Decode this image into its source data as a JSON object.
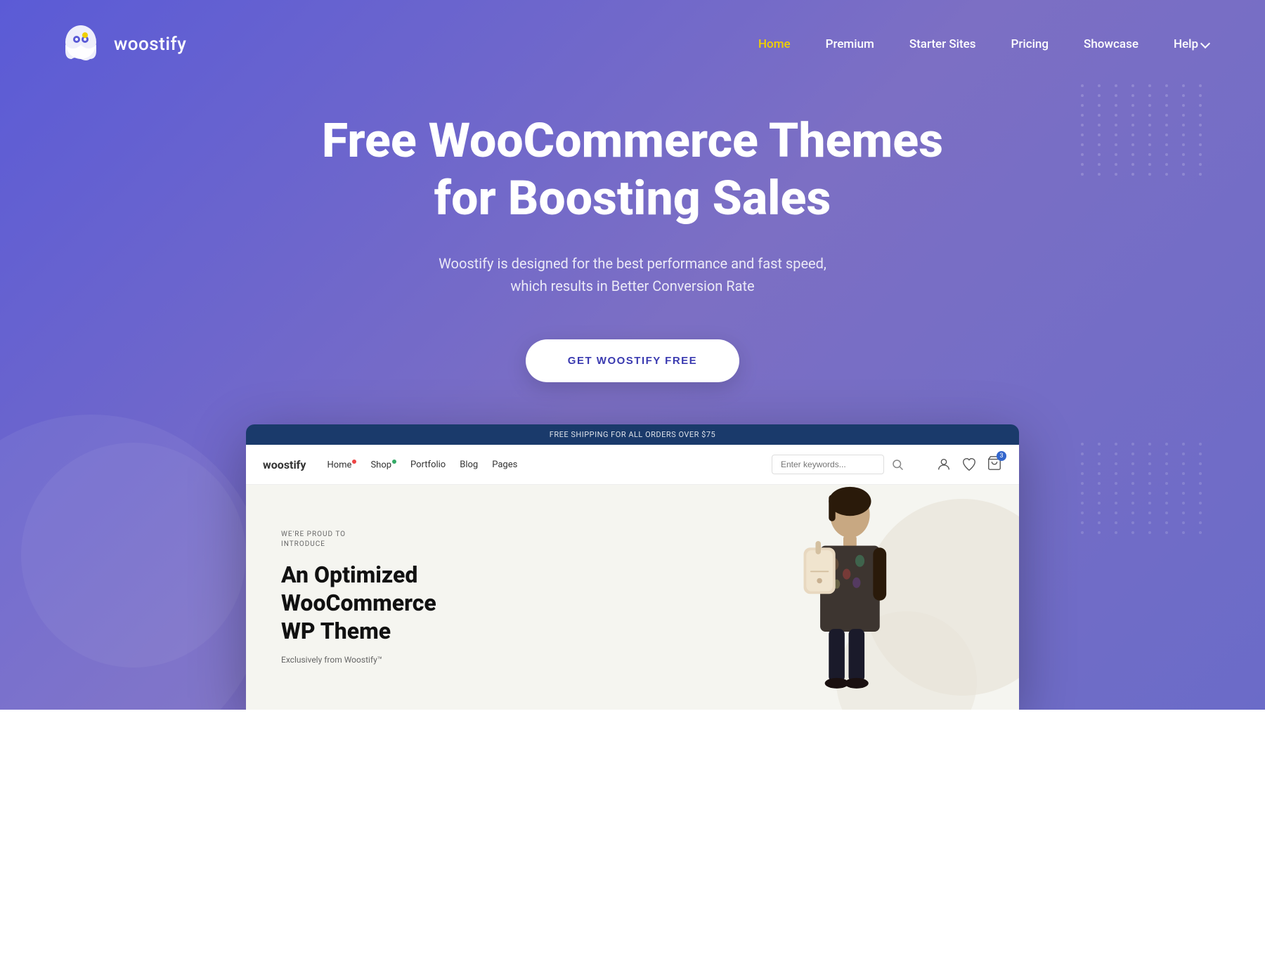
{
  "logo": {
    "text": "woostify"
  },
  "nav": {
    "items": [
      {
        "label": "Home",
        "active": true
      },
      {
        "label": "Premium",
        "active": false
      },
      {
        "label": "Starter Sites",
        "active": false
      },
      {
        "label": "Pricing",
        "active": false
      },
      {
        "label": "Showcase",
        "active": false
      },
      {
        "label": "Help",
        "active": false,
        "hasDropdown": true
      }
    ]
  },
  "hero": {
    "title_line1": "Free WooCommerce Themes",
    "title_line2": "for Boosting Sales",
    "subtitle_line1": "Woostify is designed for the best performance and fast speed,",
    "subtitle_line2": "which results in Better Conversion Rate",
    "cta_label": "GET WOOSTIFY FREE"
  },
  "browser_mockup": {
    "announcement": "FREE SHIPPING FOR ALL ORDERS OVER $75",
    "logo": "woostify",
    "nav_items": [
      "Home",
      "Shop",
      "Portfolio",
      "Blog",
      "Pages"
    ],
    "search_placeholder": "Enter keywords...",
    "introduce_label": "WE'RE PROUD TO\nINTRODUCE",
    "headline_line1": "An Optimized",
    "headline_line2": "WooCommerce",
    "headline_line3": "WP Theme",
    "subline": "Exclusively from Woostify™",
    "cart_count": "3"
  },
  "colors": {
    "hero_gradient_start": "#5b5bd6",
    "hero_gradient_end": "#7c6fc4",
    "nav_active": "#f0d000",
    "cta_text": "#3a3ab0",
    "browser_topbar": "#1a3a6b"
  }
}
